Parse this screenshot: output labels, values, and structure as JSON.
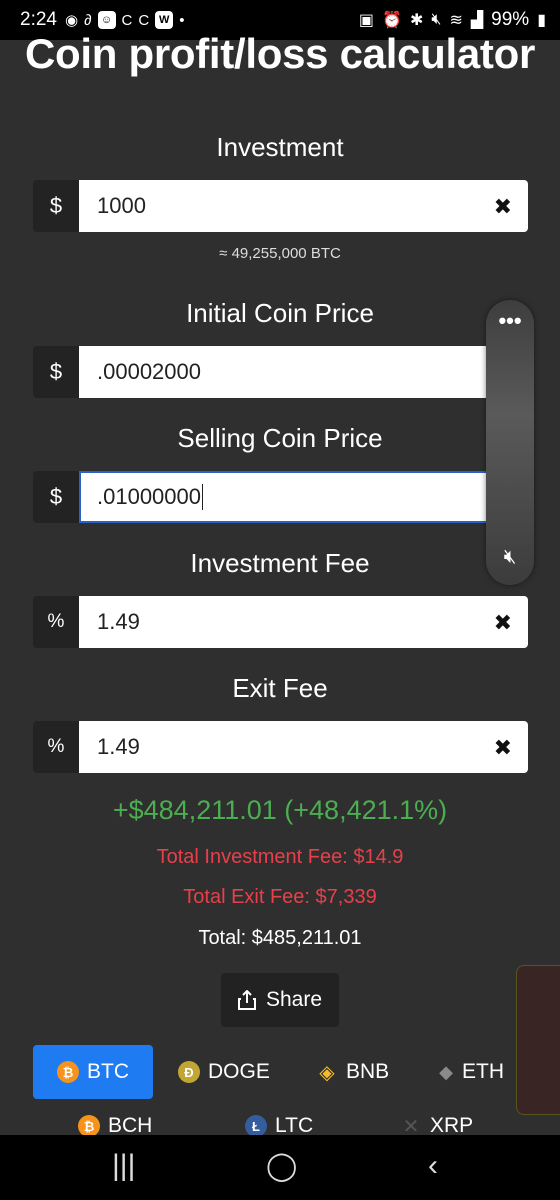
{
  "status": {
    "time": "2:24",
    "battery": "99%"
  },
  "title": "Coin profit/loss calculator",
  "investment": {
    "label": "Investment",
    "prefix": "$",
    "value": "1000",
    "note": "≈ 49,255,000 BTC"
  },
  "initial_price": {
    "label": "Initial Coin Price",
    "prefix": "$",
    "value": ".00002000"
  },
  "selling_price": {
    "label": "Selling Coin Price",
    "prefix": "$",
    "value": ".01000000"
  },
  "investment_fee": {
    "label": "Investment Fee",
    "prefix": "%",
    "value": "1.49"
  },
  "exit_fee": {
    "label": "Exit Fee",
    "prefix": "%",
    "value": "1.49"
  },
  "results": {
    "profit": "+$484,211.01 (+48,421.1%)",
    "total_investment_fee": "Total Investment Fee: $14.9",
    "total_exit_fee": "Total Exit Fee: $7,339",
    "total": "Total: $485,211.01"
  },
  "share_label": "Share",
  "coins": [
    {
      "label": "BTC",
      "icon": "bitcoin-icon",
      "color": "#f7931a"
    },
    {
      "label": "DOGE",
      "icon": "doge-icon",
      "color": "#c2a633"
    },
    {
      "label": "BNB",
      "icon": "bnb-icon",
      "color": "#f3ba2f"
    },
    {
      "label": "ETH",
      "icon": "eth-icon",
      "color": "#8a8a8a"
    },
    {
      "label": "BCH",
      "icon": "bch-icon",
      "color": "#f7931a"
    },
    {
      "label": "LTC",
      "icon": "ltc-icon",
      "color": "#345d9d"
    },
    {
      "label": "XRP",
      "icon": "xrp-icon",
      "color": "#555555"
    }
  ],
  "colors": {
    "profit": "#4cae50",
    "fee": "#e8404a",
    "accent": "#1e7bf2",
    "background": "#2f2f2f"
  }
}
